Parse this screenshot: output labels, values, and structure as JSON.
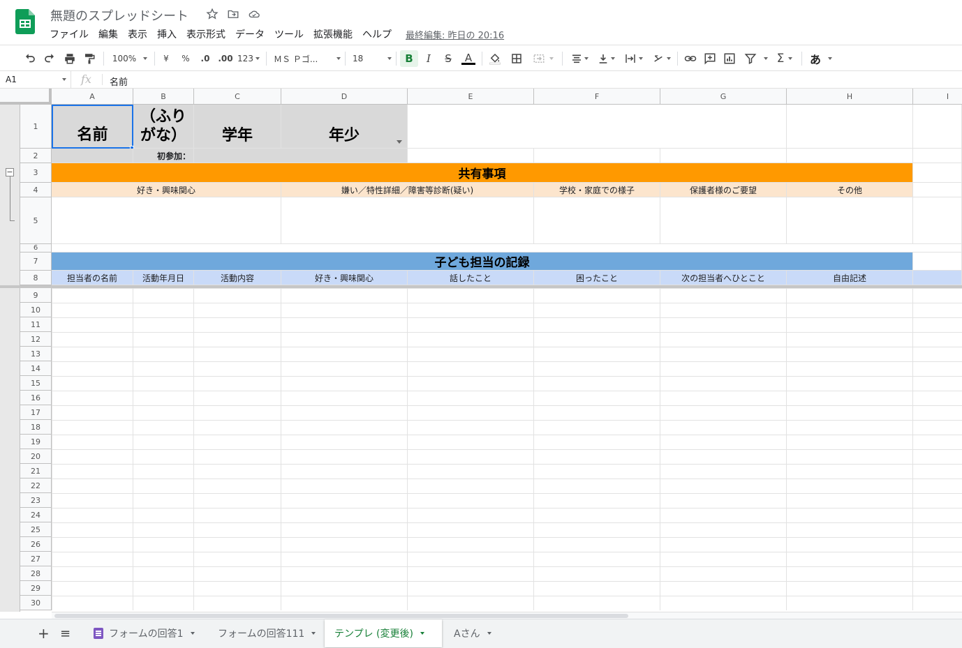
{
  "header": {
    "title": "無題のスプレッドシート",
    "menu": [
      "ファイル",
      "編集",
      "表示",
      "挿入",
      "表示形式",
      "データ",
      "ツール",
      "拡張機能",
      "ヘルプ"
    ],
    "last_edit": "最終編集: 昨日の 20:16"
  },
  "toolbar": {
    "zoom": "100%",
    "currency": "¥",
    "percent": "%",
    "dec_decrease": ".0",
    "dec_increase": ".00",
    "format_more": "123",
    "font": "ＭＳ Ｐゴ...",
    "font_size": "18",
    "bold": "B",
    "italic": "I",
    "strike": "S",
    "text_color": "A",
    "input_tools": "あ"
  },
  "formula_bar": {
    "cell_ref": "A1",
    "fx": "fx",
    "content": "名前"
  },
  "columns": [
    "A",
    "B",
    "C",
    "D",
    "E",
    "F",
    "G",
    "H",
    "I"
  ],
  "rows": [
    "1",
    "2",
    "3",
    "4",
    "5",
    "6",
    "7",
    "8",
    "9",
    "10",
    "11",
    "12",
    "13",
    "14",
    "15",
    "16",
    "17",
    "18",
    "19",
    "20",
    "21",
    "22",
    "23",
    "24",
    "25",
    "26",
    "27",
    "28",
    "29",
    "30"
  ],
  "cells": {
    "a1": "名前",
    "b1": "（ふりがな）",
    "c1": "学年",
    "d1": "年少",
    "b2": "初参加：",
    "shared_header": "共有事項",
    "shared_cols": [
      "好き・興味関心",
      "嫌い／特性詳細／障害等診断(疑い)",
      "学校・家庭での様子",
      "保護者様のご要望",
      "その他"
    ],
    "record_header": "子ども担当の記録",
    "record_cols": [
      "担当者の名前",
      "活動年月日",
      "活動内容",
      "好き・興味関心",
      "話したこと",
      "困ったこと",
      "次の担当者へひとこと",
      "自由記述"
    ]
  },
  "colors": {
    "orange": "#ff9900",
    "peach": "#fce5cd",
    "blue": "#6fa8dc",
    "light_blue": "#c9daf8",
    "gray": "#d9d9d9",
    "sheets_green": "#188038"
  },
  "sheets": [
    {
      "label": "フォームの回答1",
      "active": false,
      "form_icon": true
    },
    {
      "label": "フォームの回答111",
      "active": false
    },
    {
      "label": "テンプレ (変更後)",
      "active": true
    },
    {
      "label": "Aさん",
      "active": false
    }
  ],
  "sheetbar": {
    "add": "+",
    "all": "≡"
  }
}
